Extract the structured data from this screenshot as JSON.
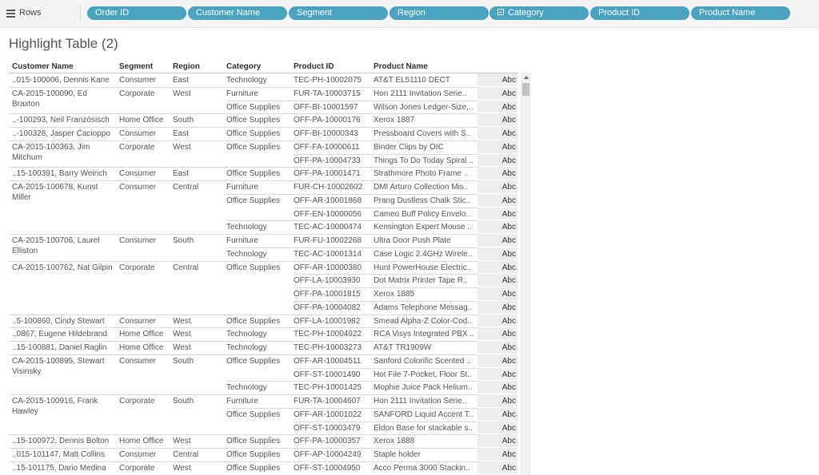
{
  "shelf": {
    "label": "Rows",
    "pills": [
      {
        "label": "Order ID",
        "icon": ""
      },
      {
        "label": "Customer Name",
        "icon": ""
      },
      {
        "label": "Segment",
        "icon": ""
      },
      {
        "label": "Region",
        "icon": ""
      },
      {
        "label": "Category",
        "icon": "collapse-box"
      },
      {
        "label": "Product ID",
        "icon": ""
      },
      {
        "label": "Product Name",
        "icon": ""
      }
    ]
  },
  "sheet": {
    "title": "Highlight Table (2)",
    "headers": [
      "Customer Name",
      "Segment",
      "Region",
      "Category",
      "Product ID",
      "Product Name"
    ]
  },
  "rows": [
    {
      "customer": "..015-100006, Dennis Kane",
      "segment": "Consumer",
      "region": "East",
      "category": "Technology",
      "product_id": "TEC-PH-10002075",
      "product_name": "AT&T EL51110 DECT",
      "value": "Abc"
    },
    {
      "customer": "CA-2015-100090, Ed Braxton",
      "segment": "Corporate",
      "region": "West",
      "category": "Furniture",
      "product_id": "FUR-TA-10003715",
      "product_name": "Hon 2111 Invitation Serie..",
      "value": "Abc"
    },
    {
      "customer": "",
      "segment": "",
      "region": "",
      "category": "Office Supplies",
      "product_id": "OFF-BI-10001597",
      "product_name": "Wilson Jones Ledger-Size,..",
      "value": "Abc"
    },
    {
      "customer": "..-100293, Neil Französisch",
      "segment": "Home Office",
      "region": "South",
      "category": "Office Supplies",
      "product_id": "OFF-PA-10000176",
      "product_name": "Xerox 1887",
      "value": "Abc"
    },
    {
      "customer": "..-100328, Jasper Cacioppo",
      "segment": "Consumer",
      "region": "East",
      "category": "Office Supplies",
      "product_id": "OFF-BI-10000343",
      "product_name": "Pressboard Covers with S..",
      "value": "Abc"
    },
    {
      "customer": "CA-2015-100363, Jim Mitchum",
      "segment": "Corporate",
      "region": "West",
      "category": "Office Supplies",
      "product_id": "OFF-FA-10000611",
      "product_name": "Binder Clips by OIC",
      "value": "Abc"
    },
    {
      "customer": "",
      "segment": "",
      "region": "",
      "category": "",
      "product_id": "OFF-PA-10004733",
      "product_name": "Things To Do Today Spiral ..",
      "value": "Abc"
    },
    {
      "customer": "..15-100391, Barry Weirich",
      "segment": "Consumer",
      "region": "East",
      "category": "Office Supplies",
      "product_id": "OFF-PA-10001471",
      "product_name": "Strathmore Photo Frame ..",
      "value": "Abc"
    },
    {
      "customer": "CA-2015-100678, Kunst Miller",
      "segment": "Consumer",
      "region": "Central",
      "category": "Furniture",
      "product_id": "FUR-CH-10002602",
      "product_name": "DMI Arturo Collection Mis..",
      "value": "Abc"
    },
    {
      "customer": "",
      "segment": "",
      "region": "",
      "category": "Office Supplies",
      "product_id": "OFF-AR-10001868",
      "product_name": "Prang Dustless Chalk Stic..",
      "value": "Abc"
    },
    {
      "customer": "",
      "segment": "",
      "region": "",
      "category": "",
      "product_id": "OFF-EN-10000056",
      "product_name": "Cameo Buff Policy Envelo..",
      "value": "Abc"
    },
    {
      "customer": "",
      "segment": "",
      "region": "",
      "category": "Technology",
      "product_id": "TEC-AC-10000474",
      "product_name": "Kensington Expert Mouse ..",
      "value": "Abc"
    },
    {
      "customer": "CA-2015-100706, Laurel Elliston",
      "segment": "Consumer",
      "region": "South",
      "category": "Furniture",
      "product_id": "FUR-FU-10002268",
      "product_name": "Ultra Door Push Plate",
      "value": "Abc"
    },
    {
      "customer": "",
      "segment": "",
      "region": "",
      "category": "Technology",
      "product_id": "TEC-AC-10001314",
      "product_name": "Case Logic 2.4GHz Wirele..",
      "value": "Abc"
    },
    {
      "customer": "CA-2015-100762, Nat Gilpin",
      "segment": "Corporate",
      "region": "Central",
      "category": "Office Supplies",
      "product_id": "OFF-AR-10000380",
      "product_name": "Hunt PowerHouse Electric..",
      "value": "Abc"
    },
    {
      "customer": "",
      "segment": "",
      "region": "",
      "category": "",
      "product_id": "OFF-LA-10003930",
      "product_name": "Dot Matrix Printer Tape R..",
      "value": "Abc"
    },
    {
      "customer": "",
      "segment": "",
      "region": "",
      "category": "",
      "product_id": "OFF-PA-10001815",
      "product_name": "Xerox 1885",
      "value": "Abc"
    },
    {
      "customer": "",
      "segment": "",
      "region": "",
      "category": "",
      "product_id": "OFF-PA-10004082",
      "product_name": "Adams Telephone Messag..",
      "value": "Abc"
    },
    {
      "customer": "..5-100860, Cindy Stewart",
      "segment": "Consumer",
      "region": "West",
      "category": "Office Supplies",
      "product_id": "OFF-LA-10001982",
      "product_name": "Smead Alpha-Z Color-Cod..",
      "value": "Abc"
    },
    {
      "customer": "..0867, Eugene Hildebrand",
      "segment": "Home Office",
      "region": "West",
      "category": "Technology",
      "product_id": "TEC-PH-10004922",
      "product_name": "RCA Visys Integrated PBX ..",
      "value": "Abc"
    },
    {
      "customer": "..15-100881, Daniel Raglin",
      "segment": "Home Office",
      "region": "West",
      "category": "Technology",
      "product_id": "TEC-PH-10003273",
      "product_name": "AT&T TR1909W",
      "value": "Abc"
    },
    {
      "customer": "CA-2015-100895, Stewart Visinsky",
      "segment": "Consumer",
      "region": "South",
      "category": "Office Supplies",
      "product_id": "OFF-AR-10004511",
      "product_name": "Sanford Colorific Scented ..",
      "value": "Abc"
    },
    {
      "customer": "",
      "segment": "",
      "region": "",
      "category": "",
      "product_id": "OFF-ST-10001490",
      "product_name": "Hot File 7-Pocket, Floor St..",
      "value": "Abc"
    },
    {
      "customer": "",
      "segment": "",
      "region": "",
      "category": "Technology",
      "product_id": "TEC-PH-10001425",
      "product_name": "Mophie Juice Pack Helium..",
      "value": "Abc"
    },
    {
      "customer": "CA-2015-100916, Frank Hawley",
      "segment": "Corporate",
      "region": "South",
      "category": "Furniture",
      "product_id": "FUR-TA-10004607",
      "product_name": "Hon 2111 Invitation Serie..",
      "value": "Abc"
    },
    {
      "customer": "",
      "segment": "",
      "region": "",
      "category": "Office Supplies",
      "product_id": "OFF-AR-10001022",
      "product_name": "SANFORD Liquid Accent T..",
      "value": "Abc"
    },
    {
      "customer": "",
      "segment": "",
      "region": "",
      "category": "",
      "product_id": "OFF-ST-10003479",
      "product_name": "Eldon Base for stackable s..",
      "value": "Abc"
    },
    {
      "customer": "..15-100972, Dennis Bolton",
      "segment": "Home Office",
      "region": "West",
      "category": "Office Supplies",
      "product_id": "OFF-PA-10000357",
      "product_name": "Xerox 1888",
      "value": "Abc"
    },
    {
      "customer": "..015-101147, Matt Collins",
      "segment": "Consumer",
      "region": "Central",
      "category": "Office Supplies",
      "product_id": "OFF-AP-10004249",
      "product_name": "Staple holder",
      "value": "Abc"
    },
    {
      "customer": "..15-101175, Dario Medina",
      "segment": "Corporate",
      "region": "West",
      "category": "Office Supplies",
      "product_id": "OFF-ST-10004950",
      "product_name": "Acco Perma 3000 Stackin..",
      "value": "Abc"
    }
  ],
  "colors": {
    "pill": "#4ba3c2",
    "cell": "#ececec",
    "shelf": "#f5f5f5"
  }
}
